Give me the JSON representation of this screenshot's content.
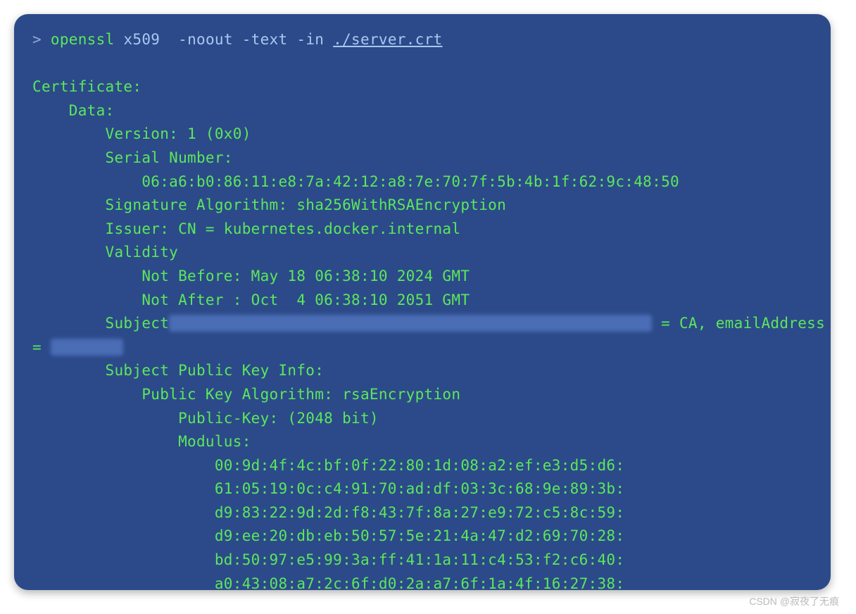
{
  "prompt": {
    "symbol": ">",
    "command": "openssl",
    "subcommand": "x509",
    "args": "  -noout -text -in ",
    "path": "./server.crt"
  },
  "output": {
    "certificate_label": "Certificate:",
    "data_label": "    Data:",
    "version": "        Version: 1 (0x0)",
    "serial_label": "        Serial Number:",
    "serial_value": "            06:a6:b0:86:11:e8:7a:42:12:a8:7e:70:7f:5b:4b:1f:62:9c:48:50",
    "sig_algo": "        Signature Algorithm: sha256WithRSAEncryption",
    "issuer": "        Issuer: CN = kubernetes.docker.internal",
    "validity_label": "        Validity",
    "not_before": "            Not Before: May 18 06:38:10 2024 GMT",
    "not_after": "            Not After : Oct  4 06:38:10 2051 GMT",
    "subject_prefix": "        Subject",
    "subject_suffix": " = CA, emailAddress ",
    "subject_line2_prefix": "= ",
    "spki_label": "        Subject Public Key Info:",
    "pk_algo": "            Public Key Algorithm: rsaEncryption",
    "pk_bits": "                Public-Key: (2048 bit)",
    "modulus_label": "                Modulus:",
    "modulus_lines": [
      "                    00:9d:4f:4c:bf:0f:22:80:1d:08:a2:ef:e3:d5:d6:",
      "                    61:05:19:0c:c4:91:70:ad:df:03:3c:68:9e:89:3b:",
      "                    d9:83:22:9d:2d:f8:43:7f:8a:27:e9:72:c5:8c:59:",
      "                    d9:ee:20:db:eb:50:57:5e:21:4a:47:d2:69:70:28:",
      "                    bd:50:97:e5:99:3a:ff:41:1a:11:c4:53:f2:c6:40:",
      "                    a0:43:08:a7:2c:6f:d0:2a:a7:6f:1a:4f:16:27:38:"
    ]
  },
  "watermark": "CSDN @寂夜了无痕"
}
